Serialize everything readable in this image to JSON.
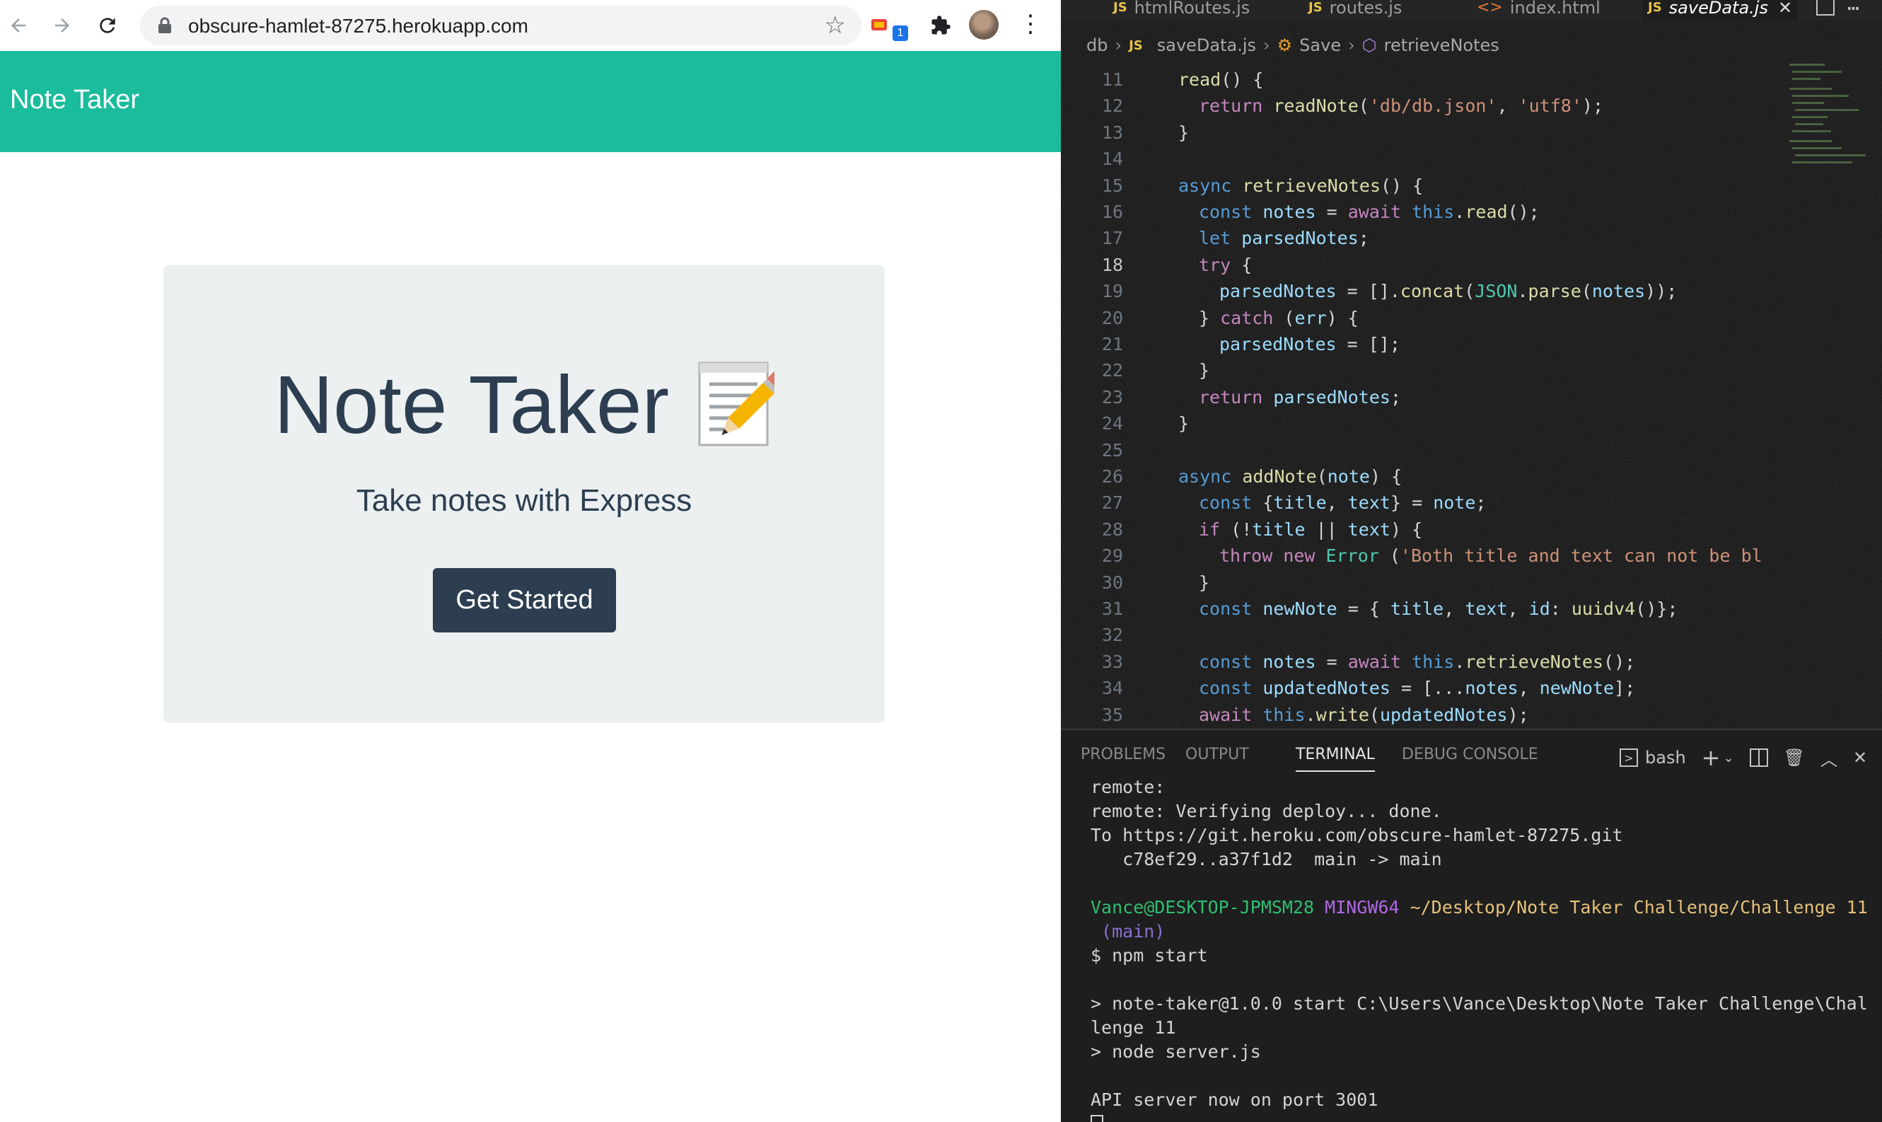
{
  "browser": {
    "url": "obscure-hamlet-87275.herokuapp.com",
    "extension_badge": "1",
    "navbar_brand": "Note Taker",
    "hero": {
      "title": "Note Taker",
      "emoji_icon": "memo-icon",
      "lead": "Take notes with Express",
      "button_label": "Get Started"
    },
    "colors": {
      "navbar": "#1abc9c",
      "jumbotron": "#ecf0f1",
      "button": "#2c3e50"
    }
  },
  "editor": {
    "tabs": [
      {
        "label": "htmlRoutes.js",
        "icon": "JS"
      },
      {
        "label": "routes.js",
        "icon": "JS"
      },
      {
        "label": "index.html",
        "icon": "<>"
      },
      {
        "label": "saveData.js",
        "icon": "JS",
        "active": true
      }
    ],
    "breadcrumb": [
      "db",
      "saveData.js",
      "Save",
      "retrieveNotes"
    ],
    "current_line": "18",
    "code_lines": [
      {
        "n": "11",
        "text": "read() {"
      },
      {
        "n": "12",
        "text": "return readNote('db/db.json', 'utf8');"
      },
      {
        "n": "13",
        "text": "}"
      },
      {
        "n": "14",
        "text": ""
      },
      {
        "n": "15",
        "text": "async retrieveNotes() {"
      },
      {
        "n": "16",
        "text": "const notes = await this.read();"
      },
      {
        "n": "17",
        "text": "let parsedNotes;"
      },
      {
        "n": "18",
        "text": "try {"
      },
      {
        "n": "19",
        "text": "parsedNotes = [].concat(JSON.parse(notes));"
      },
      {
        "n": "20",
        "text": "} catch (err) {"
      },
      {
        "n": "21",
        "text": "parsedNotes = [];"
      },
      {
        "n": "22",
        "text": "}"
      },
      {
        "n": "23",
        "text": "return parsedNotes;"
      },
      {
        "n": "24",
        "text": "}"
      },
      {
        "n": "25",
        "text": ""
      },
      {
        "n": "26",
        "text": "async addNote(note) {"
      },
      {
        "n": "27",
        "text": "const {title, text} = note;"
      },
      {
        "n": "28",
        "text": "if (!title || text) {"
      },
      {
        "n": "29",
        "text": "throw new Error ('Both title and text can not be bl"
      },
      {
        "n": "30",
        "text": "}"
      },
      {
        "n": "31",
        "text": "const newNote = { title, text, id: uuidv4()};"
      },
      {
        "n": "32",
        "text": ""
      },
      {
        "n": "33",
        "text": "const notes = await this.retrieveNotes();"
      },
      {
        "n": "34",
        "text": "const updatedNotes = [...notes, newNote];"
      },
      {
        "n": "35",
        "text": "await this.write(updatedNotes);"
      }
    ],
    "panel_tabs": [
      "PROBLEMS",
      "OUTPUT",
      "TERMINAL",
      "DEBUG CONSOLE"
    ],
    "active_panel_tab": "TERMINAL",
    "shell_name": "bash",
    "terminal": {
      "lines_before": [
        "remote:",
        "remote: Verifying deploy... done.",
        "To https://git.heroku.com/obscure-hamlet-87275.git",
        "   c78ef29..a37f1d2  main -> main",
        ""
      ],
      "prompt_user": "Vance@DESKTOP-JPMSM28",
      "prompt_env": "MINGW64",
      "prompt_path": "~/Desktop/Note Taker Challenge/Challenge 11",
      "prompt_branch": " (main)",
      "command": "$ npm start",
      "lines_after": [
        "",
        "> note-taker@1.0.0 start C:\\Users\\Vance\\Desktop\\Note Taker Challenge\\Chal",
        "lenge 11",
        "> node server.js",
        "",
        "API server now on port 3001"
      ]
    }
  }
}
